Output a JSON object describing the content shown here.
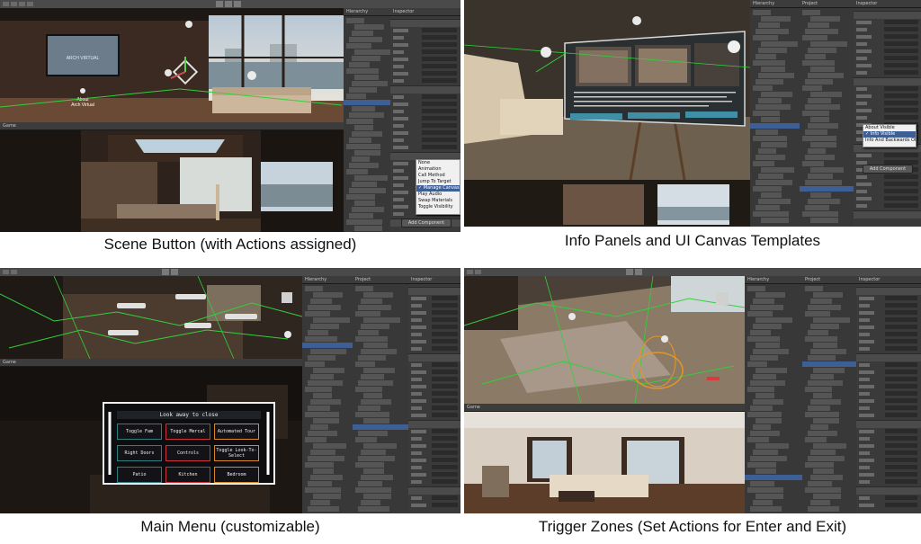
{
  "captions": {
    "scene_button": "Scene Button (with Actions assigned)",
    "info_panels": "Info Panels and UI Canvas Templates",
    "main_menu": "Main Menu (customizable)",
    "trigger_zones": "Trigger Zones (Set Actions for Enter and Exit)"
  },
  "q1": {
    "tv_logo": "ARCH VIRTUAL",
    "button_label_line1": "About",
    "button_label_line2": "Arch Virtual",
    "panel_tabs": [
      "Hierarchy",
      "Inspector"
    ],
    "dropdown_options": [
      "None",
      "Animation",
      "Call Method",
      "Jump To Target",
      "Manage Canvas",
      "Play Audio",
      "Swap Materials",
      "Toggle Visibility"
    ],
    "dropdown_selected_index": 4,
    "add_component": "Add Component"
  },
  "q2": {
    "dropdown_options": [
      "About Visible",
      "Info Visible",
      "Info And Backwards Objects"
    ],
    "dropdown_selected_index": 1,
    "add_component": "Add Component"
  },
  "q3": {
    "menu_title": "Look away to close",
    "menu_buttons": [
      "Toggle Fam",
      "Toggle Mercal",
      "Automated Tour",
      "Right Doors",
      "Controls",
      "Toggle Look-To-Select",
      "Patio",
      "Kitchen",
      "Bedroom"
    ]
  },
  "q4": {
    "panel_tabs": [
      "Hierarchy",
      "Project",
      "Inspector"
    ]
  },
  "colors": {
    "editor_bg": "#2b2b2b",
    "selection": "#3e5f96",
    "wire_green": "#33d03c",
    "menu_teal": "#2f7d7f",
    "menu_red": "#c8343a",
    "menu_orange": "#d9882a"
  }
}
